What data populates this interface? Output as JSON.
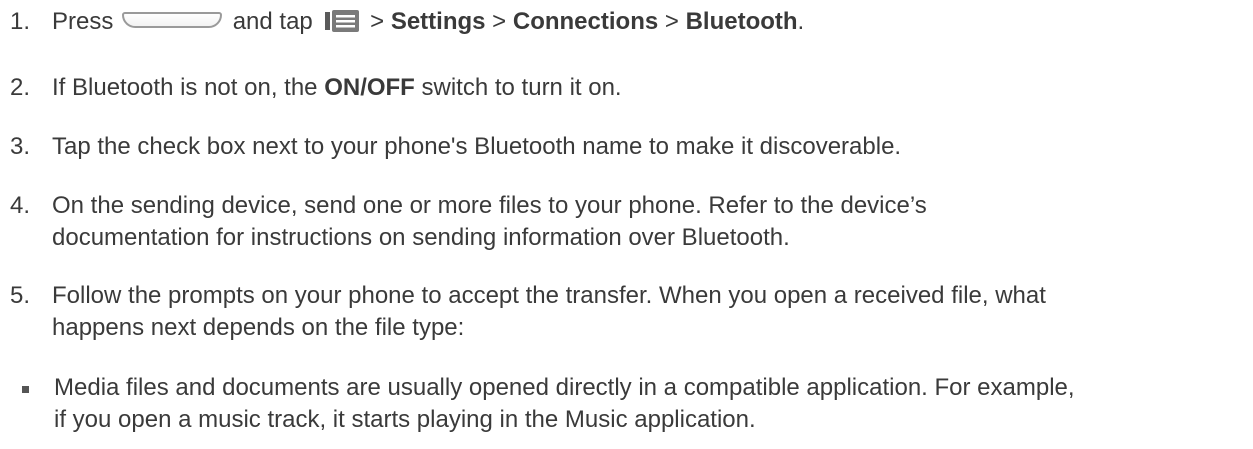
{
  "steps": [
    {
      "num": "1.",
      "text_press": "Press",
      "text_and_tap": "and tap",
      "text_sep1": ">",
      "settings": "Settings",
      "text_sep2": ">",
      "connections": "Connections",
      "text_sep3": ">",
      "bluetooth": "Bluetooth",
      "text_end": ".",
      "icons": [
        "home-key-icon",
        "menu-icon"
      ]
    },
    {
      "num": "2.",
      "text_pre": "If Bluetooth is not on, the",
      "onoff": "ON/OFF",
      "text_post": "switch to turn it on."
    },
    {
      "num": "3.",
      "text": "Tap the check box next to your phone's Bluetooth name to make it discoverable."
    },
    {
      "num": "4.",
      "line1": "On the sending device, send one or more files to your phone. Refer to the device’s",
      "line2": "documentation for instructions on sending information over Bluetooth."
    },
    {
      "num": "5.",
      "line1": "Follow the prompts on your phone to accept the transfer. When you open a received file, what",
      "line2": "happens next depends on the file type:"
    }
  ],
  "bullets": [
    {
      "line1": "Media files and documents are usually opened directly in a compatible application. For example,",
      "line2": "if you open a music track, it starts playing in the Music application."
    }
  ]
}
